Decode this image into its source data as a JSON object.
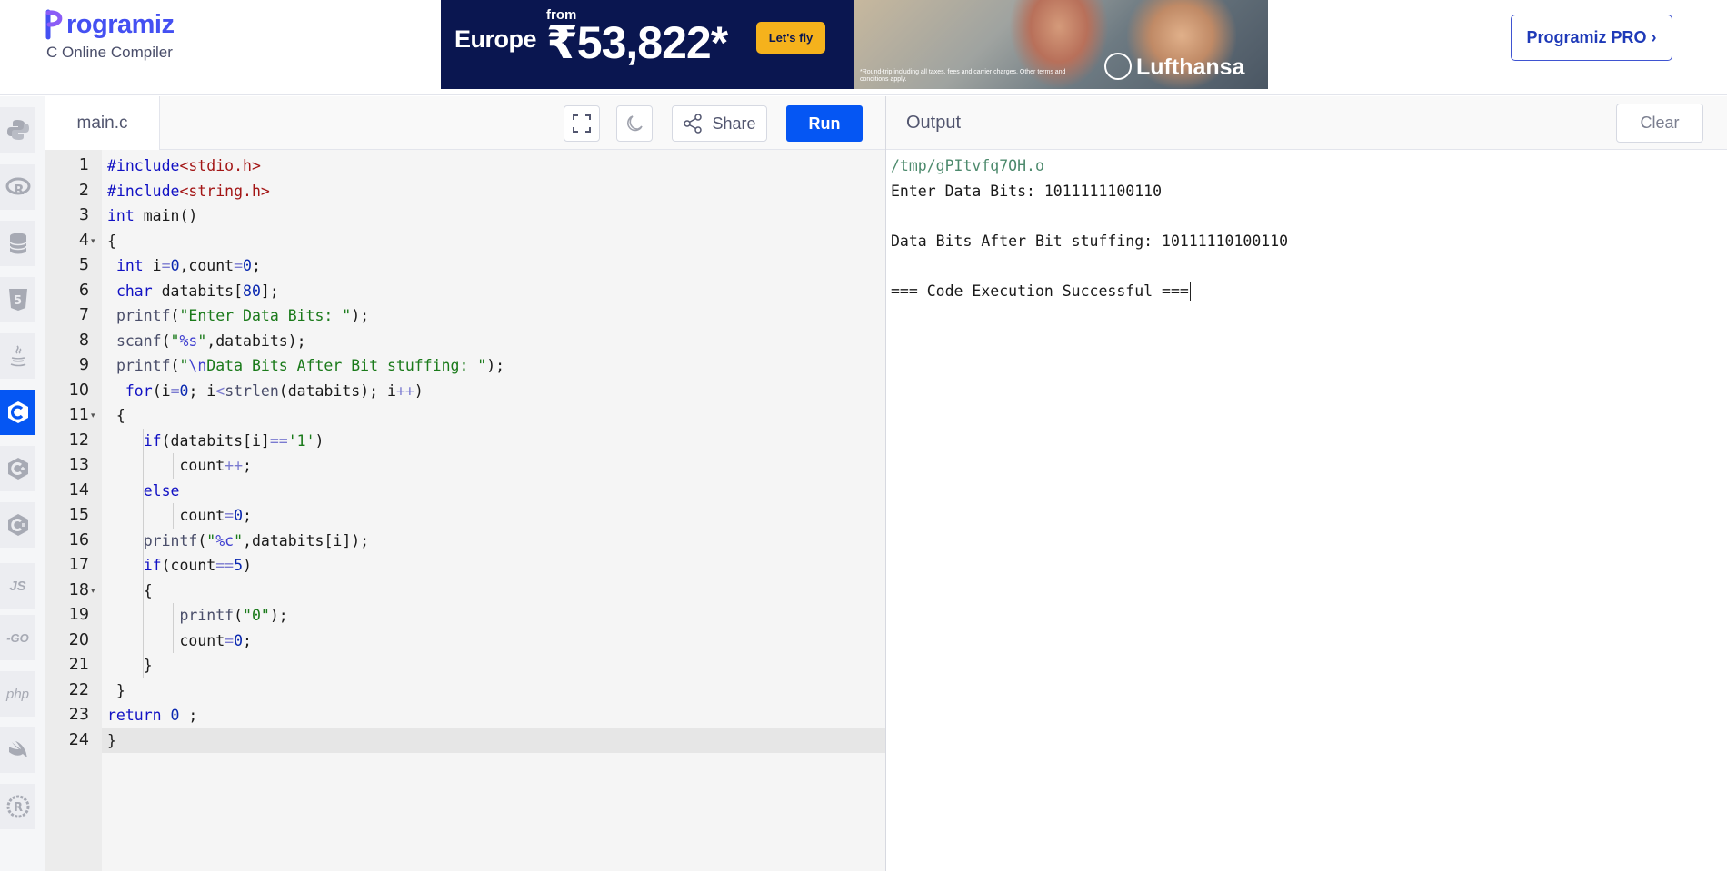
{
  "header": {
    "logo_text": "rogramiz",
    "subtitle": "C Online Compiler",
    "pro_button": "Programiz PRO ›"
  },
  "ad": {
    "destination": "Europe",
    "from_label": "from",
    "price": "₹53,822*",
    "cta": "Let's fly",
    "fine_print": "*Round-trip including all taxes, fees and carrier charges. Other terms and conditions apply.",
    "brand": "Lufthansa"
  },
  "languages": [
    {
      "name": "python-icon",
      "glyph": ""
    },
    {
      "name": "r-icon",
      "glyph": "R"
    },
    {
      "name": "sql-icon",
      "glyph": ""
    },
    {
      "name": "html-icon",
      "glyph": "5"
    },
    {
      "name": "java-icon",
      "glyph": "☕"
    },
    {
      "name": "c-icon",
      "glyph": "C",
      "active": true
    },
    {
      "name": "cpp-icon",
      "glyph": "C"
    },
    {
      "name": "csharp-icon",
      "glyph": "C"
    },
    {
      "name": "javascript-icon",
      "glyph": "JS"
    },
    {
      "name": "go-icon",
      "glyph": "-GO"
    },
    {
      "name": "php-icon",
      "glyph": "php"
    },
    {
      "name": "swift-icon",
      "glyph": ""
    },
    {
      "name": "rust-icon",
      "glyph": "R"
    }
  ],
  "editor": {
    "filename": "main.c",
    "share_label": "Share",
    "run_label": "Run",
    "active_line": 24,
    "lines": [
      "#include<stdio.h>",
      "#include<string.h>",
      "int main()",
      "{",
      " int i=0,count=0;",
      " char databits[80];",
      " printf(\"Enter Data Bits: \");",
      " scanf(\"%s\",databits);",
      " printf(\"\\nData Bits After Bit stuffing: \");",
      "  for(i=0; i<strlen(databits); i++)",
      " {",
      "    if(databits[i]=='1')",
      "        count++;",
      "    else",
      "        count=0;",
      "    printf(\"%c\",databits[i]);",
      "    if(count==5)",
      "    {",
      "        printf(\"0\");",
      "        count=0;",
      "    }",
      " }",
      "return 0 ;",
      "}"
    ]
  },
  "output": {
    "title": "Output",
    "clear_label": "Clear",
    "lines": [
      "/tmp/gPItvfq7OH.o",
      "Enter Data Bits: 1011111100110",
      "",
      "Data Bits After Bit stuffing: 10111110100110",
      "",
      "=== Code Execution Successful ==="
    ]
  }
}
